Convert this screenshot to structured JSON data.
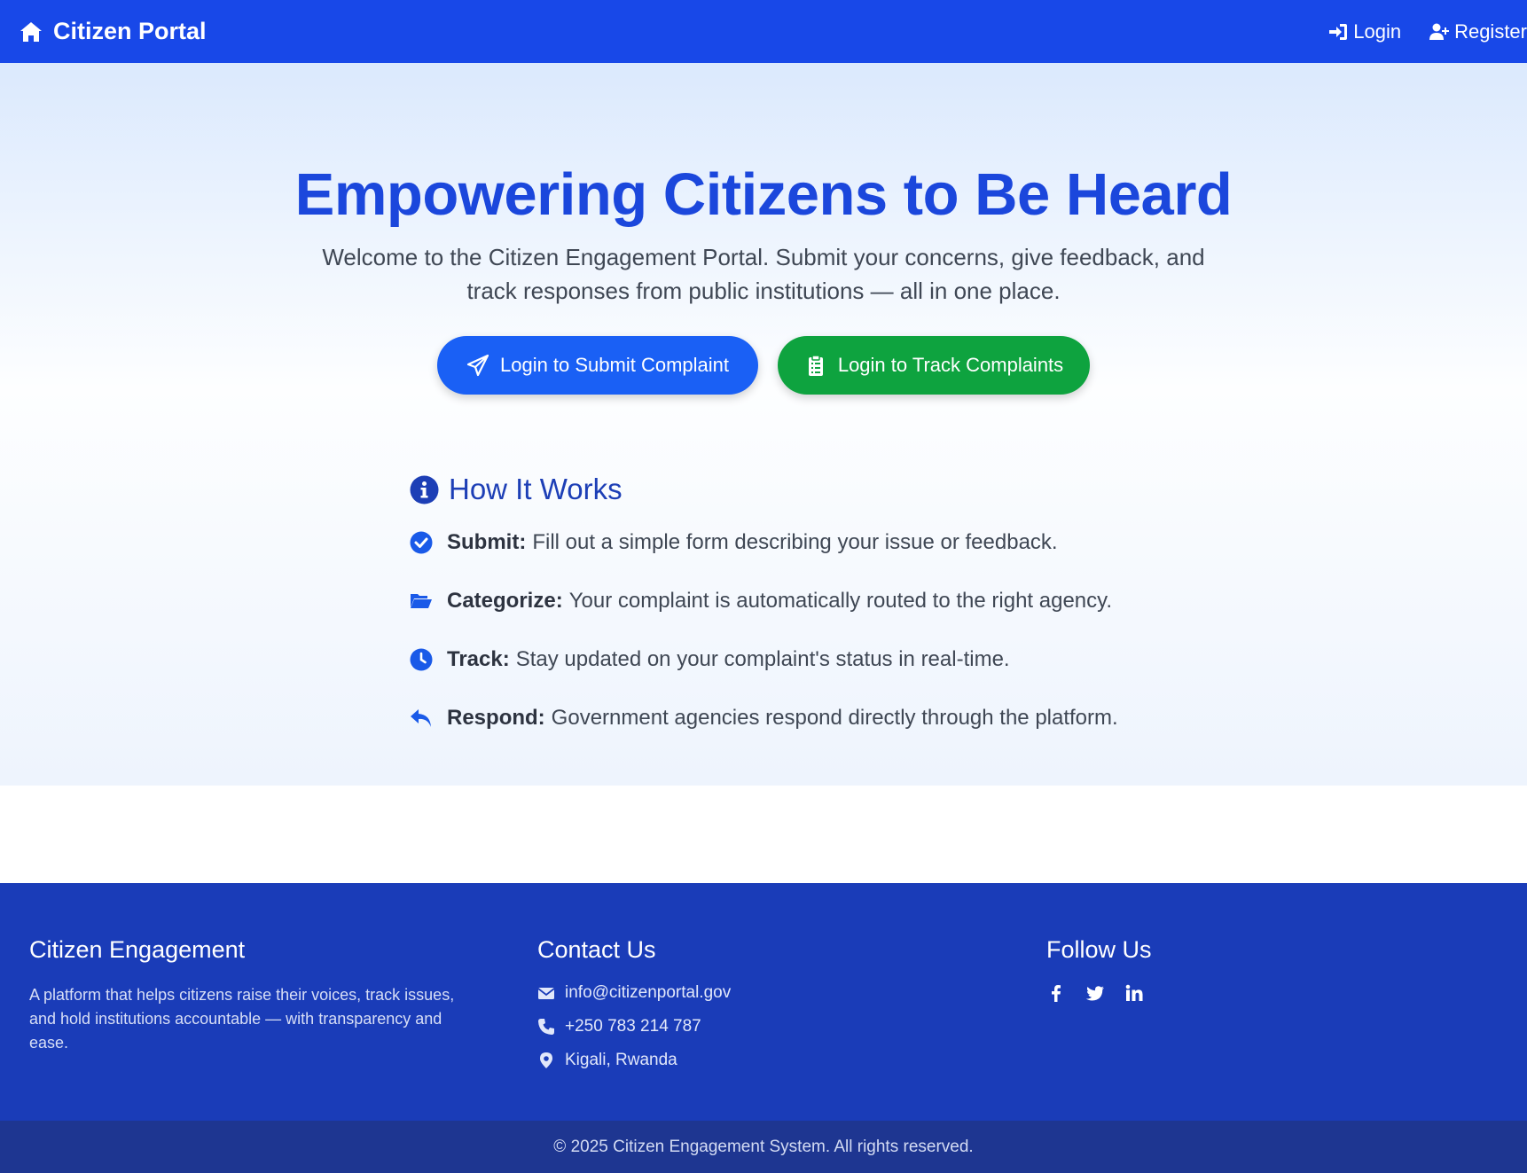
{
  "nav": {
    "brand": "Citizen Portal",
    "login": "Login",
    "register": "Register"
  },
  "hero": {
    "title": "Empowering Citizens to Be Heard",
    "subtitle": "Welcome to the Citizen Engagement Portal. Submit your concerns, give feedback, and track responses from public institutions — all in one place.",
    "submit_button": "Login to Submit Complaint",
    "track_button": "Login to Track Complaints"
  },
  "how": {
    "title": "How It Works",
    "steps": [
      {
        "label": "Submit:",
        "text": "Fill out a simple form describing your issue or feedback.",
        "icon": "check-circle-icon"
      },
      {
        "label": "Categorize:",
        "text": "Your complaint is automatically routed to the right agency.",
        "icon": "folder-open-icon"
      },
      {
        "label": "Track:",
        "text": "Stay updated on your complaint's status in real-time.",
        "icon": "clock-icon"
      },
      {
        "label": "Respond:",
        "text": "Government agencies respond directly through the platform.",
        "icon": "reply-icon"
      }
    ]
  },
  "footer": {
    "about_title": "Citizen Engagement",
    "about_text": "A platform that helps citizens raise their voices, track issues, and hold institutions accountable — with transparency and ease.",
    "contact_title": "Contact Us",
    "email": "info@citizenportal.gov",
    "phone": "+250 783 214 787",
    "location": "Kigali, Rwanda",
    "follow_title": "Follow Us",
    "copyright": "© 2025 Citizen Engagement System. All rights reserved."
  },
  "colors": {
    "primary": "#1848e8",
    "success": "#0ea33f",
    "footer": "#1a3cb8",
    "footer_bottom": "#1e3691"
  }
}
